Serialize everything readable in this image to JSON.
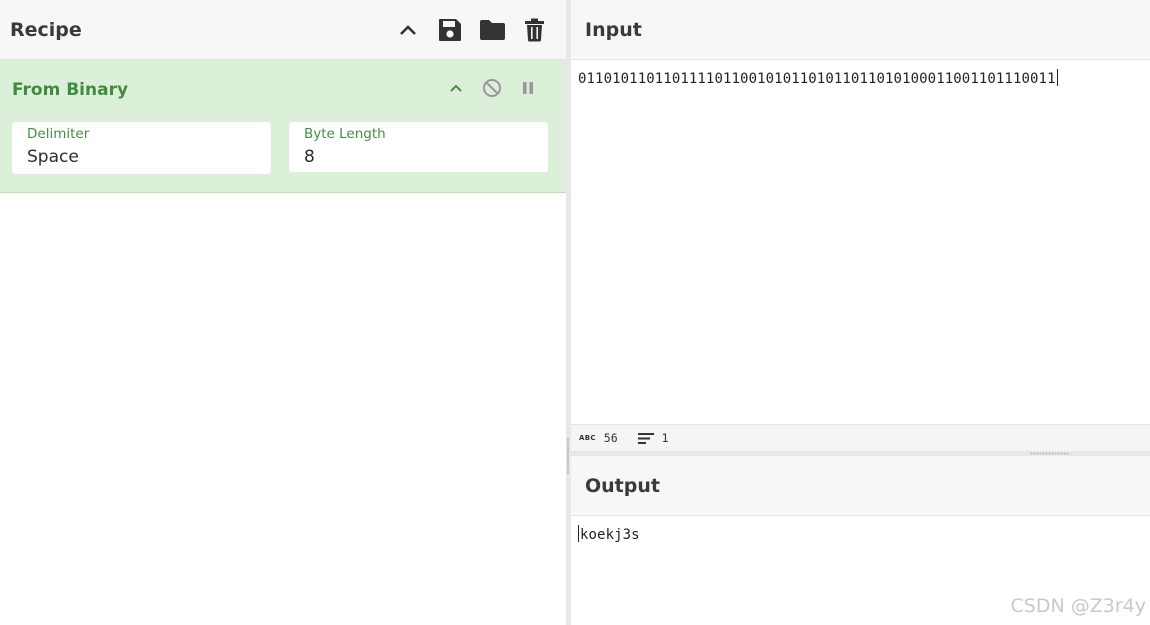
{
  "recipe": {
    "title": "Recipe",
    "tools": [
      "chevron-up-icon",
      "save-icon",
      "folder-icon",
      "trash-icon"
    ]
  },
  "operation": {
    "name": "From Binary",
    "args": {
      "delimiter_label": "Delimiter",
      "delimiter_value": "Space",
      "byte_length_label": "Byte Length",
      "byte_length_value": "8"
    }
  },
  "input": {
    "title": "Input",
    "text": "01101011011011110110010101101011011010100011001101110011"
  },
  "status": {
    "length": "56",
    "lines": "1"
  },
  "output": {
    "title": "Output",
    "text": "koekj3s"
  },
  "watermark": "CSDN @Z3r4y",
  "colors": {
    "operation_bg": "#dcefd8",
    "operation_title": "#3f8b3f",
    "header_bg": "#f7f7f7"
  }
}
